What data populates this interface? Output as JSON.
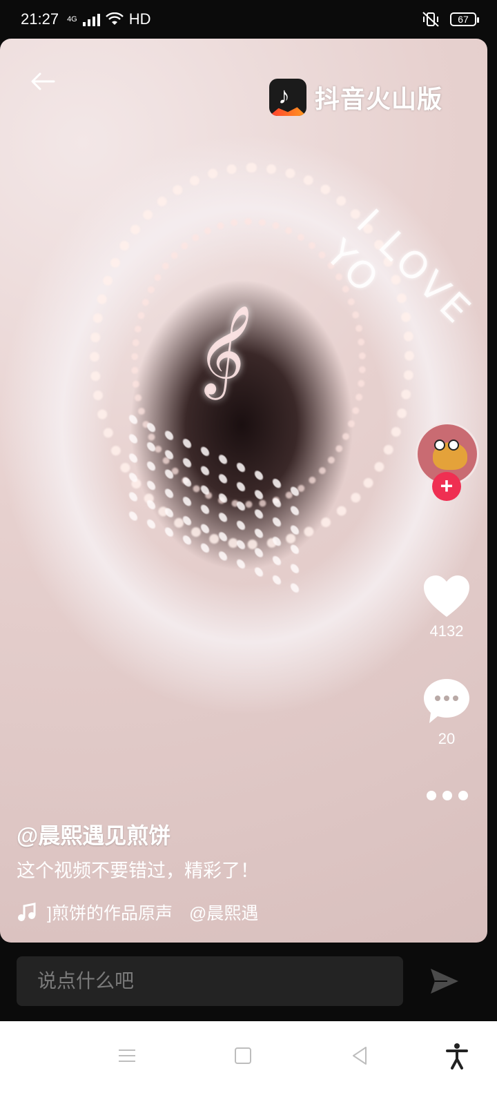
{
  "status_bar": {
    "time": "21:27",
    "network": "4G",
    "hd": "HD",
    "battery": "67"
  },
  "video": {
    "brand_name": "抖音火山版",
    "overlay_text": "I LOVE YO",
    "author": "@晨熙遇见煎饼",
    "description": "这个视频不要错过，精彩了！",
    "music_title": "]煎饼的作品原声",
    "music_author": "@晨熙遇"
  },
  "actions": {
    "like_count": "4132",
    "comment_count": "20",
    "follow_symbol": "+"
  },
  "comment_bar": {
    "placeholder": "说点什么吧"
  },
  "colors": {
    "accent": "#ef2f52",
    "background": "#0b0b0b"
  }
}
